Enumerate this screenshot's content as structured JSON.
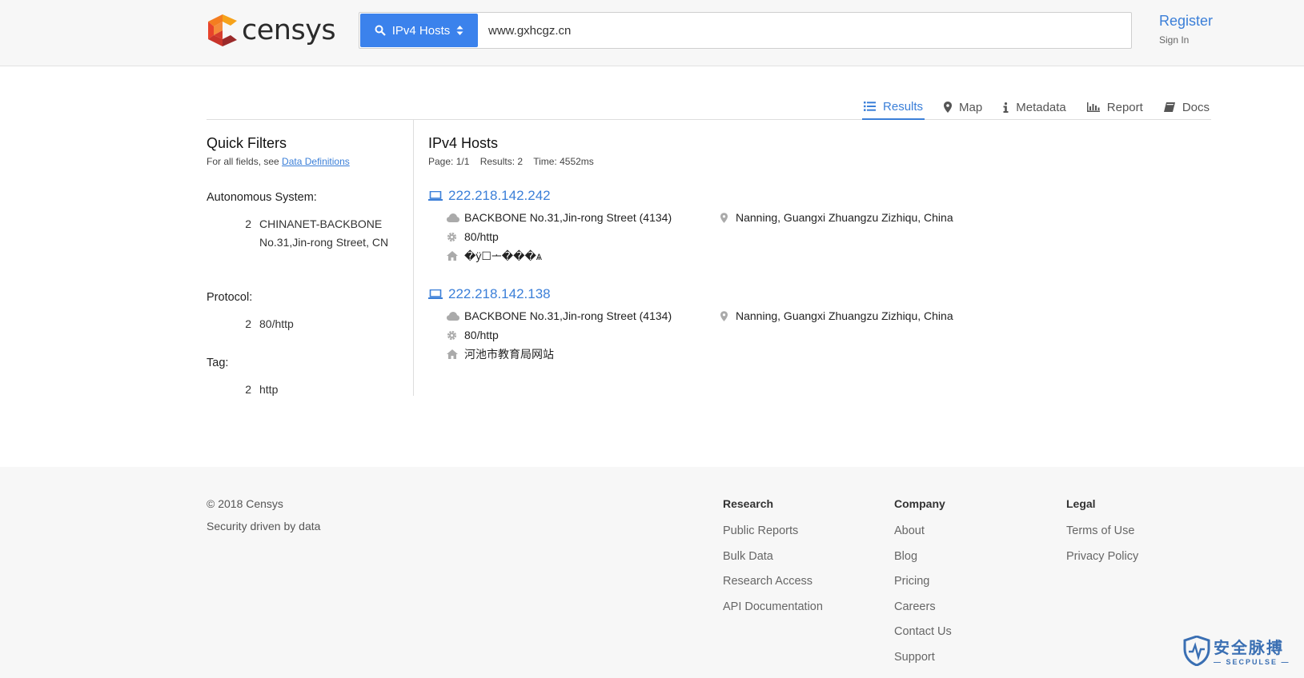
{
  "header": {
    "logo_text": "censys",
    "search_type": "IPv4 Hosts",
    "search_value": "www.gxhcgz.cn",
    "register": "Register",
    "signin": "Sign In"
  },
  "tabs": [
    {
      "label": "Results",
      "icon": "list-icon",
      "active": true
    },
    {
      "label": "Map",
      "icon": "map-marker-icon"
    },
    {
      "label": "Metadata",
      "icon": "info-icon"
    },
    {
      "label": "Report",
      "icon": "bar-chart-icon"
    },
    {
      "label": "Docs",
      "icon": "book-icon"
    }
  ],
  "sidebar": {
    "title": "Quick Filters",
    "subtitle_prefix": "For all fields, see ",
    "subtitle_link": "Data Definitions",
    "filters": [
      {
        "label": "Autonomous System:",
        "items": [
          {
            "count": "2",
            "value": "CHINANET-BACKBONE No.31,Jin-rong Street, CN"
          }
        ]
      },
      {
        "label": "Protocol:",
        "items": [
          {
            "count": "2",
            "value": "80/http"
          }
        ]
      },
      {
        "label": "Tag:",
        "items": [
          {
            "count": "2",
            "value": "http"
          }
        ]
      }
    ]
  },
  "results": {
    "title": "IPv4 Hosts",
    "page": "Page: 1/1",
    "count": "Results: 2",
    "time": "Time: 4552ms",
    "hosts": [
      {
        "ip": "222.218.142.242",
        "as": "BACKBONE No.31,Jin-rong Street (4134)",
        "location": "Nanning, Guangxi Zhuangzu Zizhiqu, China",
        "protocol": "80/http",
        "title": "�ÿ☐ᅩ���ѧ"
      },
      {
        "ip": "222.218.142.138",
        "as": "BACKBONE No.31,Jin-rong Street (4134)",
        "location": "Nanning, Guangxi Zhuangzu Zizhiqu, China",
        "protocol": "80/http",
        "title": "河池市教育局网站"
      }
    ]
  },
  "footer": {
    "copyright": "© 2018 Censys",
    "tagline": "Security driven by data",
    "columns": [
      {
        "title": "Research",
        "links": [
          "Public Reports",
          "Bulk Data",
          "Research Access",
          "API Documentation"
        ]
      },
      {
        "title": "Company",
        "links": [
          "About",
          "Blog",
          "Pricing",
          "Careers",
          "Contact Us",
          "Support"
        ]
      },
      {
        "title": "Legal",
        "links": [
          "Terms of Use",
          "Privacy Policy"
        ]
      }
    ],
    "watermark_cn": "安全脉搏",
    "watermark_en": "— SECPULSE —"
  },
  "colors": {
    "accent": "#3b82ec",
    "link": "#3b7fd8"
  }
}
